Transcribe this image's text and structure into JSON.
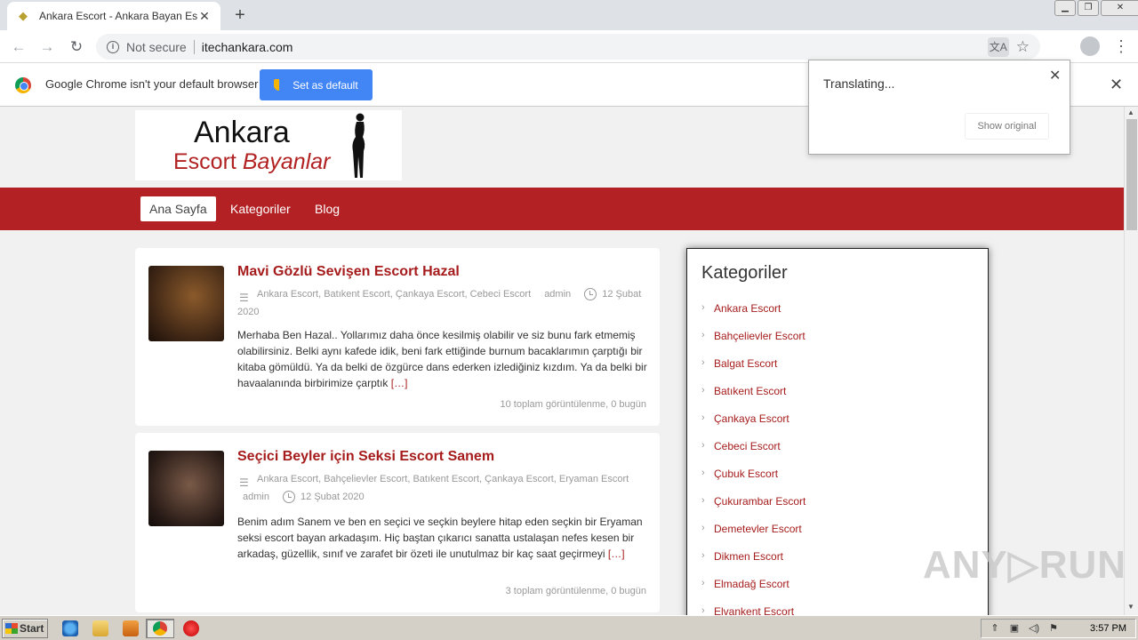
{
  "browser": {
    "tab_title": "Ankara Escort - Ankara Bayan Escort",
    "tab_close": "✕",
    "new_tab": "+",
    "security_label": "Not secure",
    "url": "itechankara.com"
  },
  "infobar": {
    "message": "Google Chrome isn't your default browser",
    "button_label": "Set as default",
    "close": "✕"
  },
  "translate_popup": {
    "title": "Translating...",
    "show_original": "Show original",
    "close": "✕"
  },
  "site": {
    "logo_line1": "Ankara",
    "logo_line2_a": "Escort",
    "logo_line2_b": "Bayanlar",
    "nav": [
      "Ana Sayfa",
      "Kategoriler",
      "Blog"
    ],
    "brand_color": "#b32124"
  },
  "posts": [
    {
      "title": "Mavi Gözlü Sevişen Escort Hazal",
      "categories": "Ankara Escort, Batıkent Escort, Çankaya Escort, Cebeci Escort",
      "author": "admin",
      "date": "12 Şubat 2020",
      "excerpt": "Merhaba Ben Hazal.. Yollarımız daha önce kesilmiş olabilir ve siz bunu fark etmemiş olabilirsiniz. Belki aynı kafede idik, beni fark ettiğinde burnum bacaklarımın çarptığı bir kitaba gömüldü. Ya da belki de özgürce dans ederken izlediğiniz kızdım. Ya da belki bir havaalanında birbirimize çarptık",
      "more": "[…]",
      "views": "10 toplam görüntülenme, 0 bugün"
    },
    {
      "title": "Seçici Beyler için Seksi Escort Sanem",
      "categories": "Ankara Escort, Bahçelievler Escort, Batıkent Escort, Çankaya Escort, Eryaman Escort",
      "author": "admin",
      "date": "12 Şubat 2020",
      "excerpt": "Benim adım Sanem ve ben en seçici ve seçkin beylere hitap eden seçkin bir Eryaman seksi escort bayan arkadaşım. Hiç baştan çıkarıcı sanatta ustalaşan nefes kesen bir arkadaş, güzellik, sınıf ve zarafet bir özeti ile unutulmaz bir kaç saat geçirmeyi",
      "more": "[…]",
      "views": "3 toplam görüntülenme, 0 bugün"
    }
  ],
  "sidebar": {
    "title": "Kategoriler",
    "items": [
      "Ankara Escort",
      "Bahçelievler Escort",
      "Balgat Escort",
      "Batıkent Escort",
      "Çankaya Escort",
      "Cebeci Escort",
      "Çubuk Escort",
      "Çukurambar Escort",
      "Demetevler Escort",
      "Dikmen Escort",
      "Elmadağ Escort",
      "Elvankent Escort"
    ]
  },
  "watermark": "ANY▷RUN",
  "taskbar": {
    "start_label": "Start",
    "clock": "3:57 PM"
  }
}
